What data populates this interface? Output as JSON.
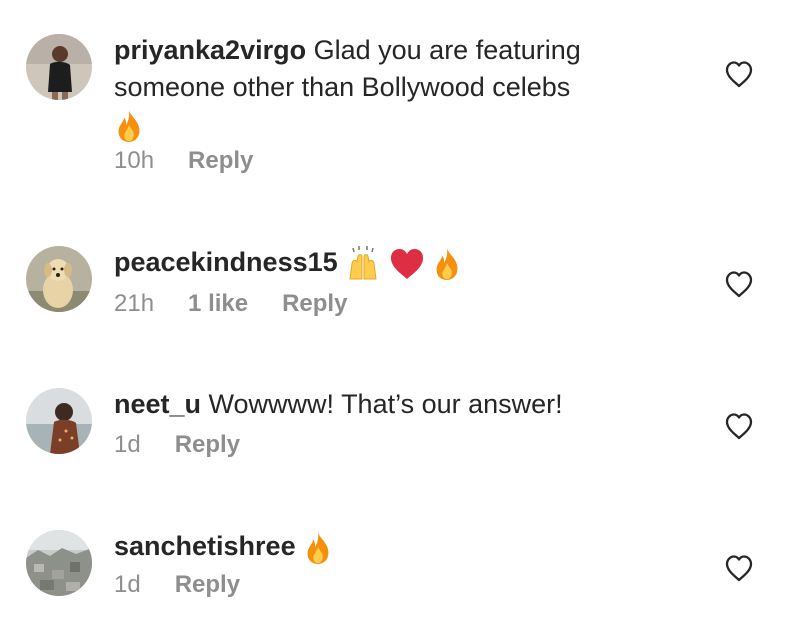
{
  "comments": [
    {
      "username": "priyanka2virgo",
      "text_line1": "Glad you are featuring",
      "text_line2": "someone other than  Bollywood celebs",
      "time": "10h",
      "reply": "Reply"
    },
    {
      "username": "peacekindness15",
      "time": "21h",
      "likes": "1 like",
      "reply": "Reply"
    },
    {
      "username": "neet_u",
      "text": "Wowwww! That’s our answer!",
      "time": "1d",
      "reply": "Reply"
    },
    {
      "username": "sanchetishree",
      "time": "1d",
      "reply": "Reply"
    }
  ],
  "icons": {
    "like": "heart-outline-icon",
    "fire": "fire-emoji",
    "raised_hands": "raised-hands-emoji",
    "red_heart": "red-heart-emoji"
  },
  "colors": {
    "text": "#262626",
    "meta": "#8e8e8e",
    "fire": "#f4900c",
    "red_heart": "#dd2e44"
  }
}
